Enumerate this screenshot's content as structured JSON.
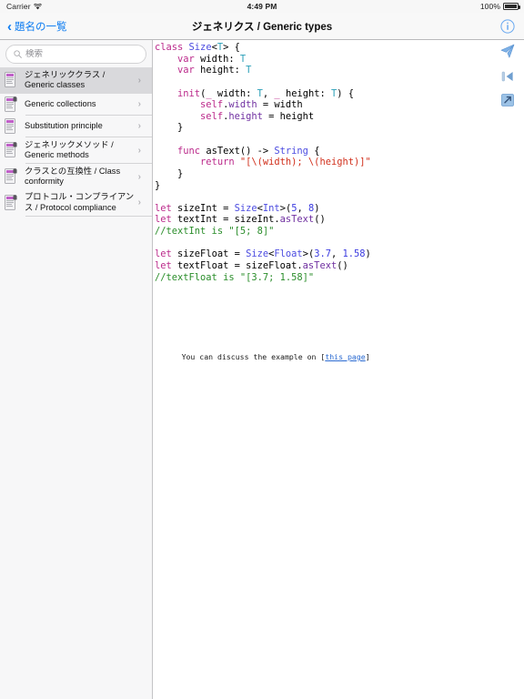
{
  "statusbar": {
    "carrier": "Carrier",
    "wifi_icon": "wifi-icon",
    "time": "4:49 PM",
    "battery_percent": "100%",
    "battery_icon": "battery-full-icon"
  },
  "navbar": {
    "back_label": "題名の一覧",
    "back_icon": "chevron-left-icon",
    "title": "ジェネリクス / Generic types",
    "info_icon": "info-circle-icon"
  },
  "sidebar": {
    "search": {
      "placeholder": "検索",
      "value": "",
      "icon": "search-icon"
    },
    "items": [
      {
        "label": "ジェネリッククラス / Generic classes",
        "icon": "document-icon",
        "locked": false,
        "selected": true,
        "chevron": "›"
      },
      {
        "label": "Generic collections",
        "icon": "document-lock-icon",
        "locked": true,
        "selected": false,
        "chevron": "›"
      },
      {
        "label": "Substitution principle",
        "icon": "document-icon",
        "locked": false,
        "selected": false,
        "chevron": "›"
      },
      {
        "label": "ジェネリックメソッド / Generic methods",
        "icon": "document-lock-icon",
        "locked": true,
        "selected": false,
        "chevron": "›"
      },
      {
        "label": "クラスとの互換性 / Class conformity",
        "icon": "document-lock-icon",
        "locked": true,
        "selected": false,
        "chevron": "›"
      },
      {
        "label": "プロトコル・コンプライアンス / Protocol compliance",
        "icon": "document-lock-icon",
        "locked": true,
        "selected": false,
        "chevron": "›"
      }
    ]
  },
  "content": {
    "code_language": "swift",
    "code_text": "class Size<T> {\n    var width: T\n    var height: T\n\n    init(_ width: T, _ height: T) {\n        self.width = width\n        self.height = height\n    }\n\n    func asText() -> String {\n        return \"[\\(width); \\(height)]\"\n    }\n}\n\nlet sizeInt = Size<Int>(5, 8)\nlet textInt = sizeInt.asText()\n//textInt is \"[5; 8]\"\n\nlet sizeFloat = Size<Float>(3.7, 1.58)\nlet textFloat = sizeFloat.asText()\n//textFloat is \"[3.7; 1.58]\"",
    "discuss_prefix": "You can discuss the example on [",
    "discuss_link": "this page",
    "discuss_suffix": "]"
  },
  "rail": {
    "buttons": [
      {
        "name": "send-icon",
        "label": "Send"
      },
      {
        "name": "skip-back-icon",
        "label": "Previous"
      },
      {
        "name": "expand-icon",
        "label": "Expand"
      }
    ]
  },
  "colors": {
    "accent": "#0b7bf1",
    "keyword": "#bb2a8b",
    "type": "#4b4be0",
    "string": "#d12f1b",
    "comment": "#2a8d2a",
    "number": "#3a3ae0",
    "property": "#6f2fa0",
    "sidebar_bg": "#f7f7f8",
    "selected_bg": "#d9d9dc"
  }
}
